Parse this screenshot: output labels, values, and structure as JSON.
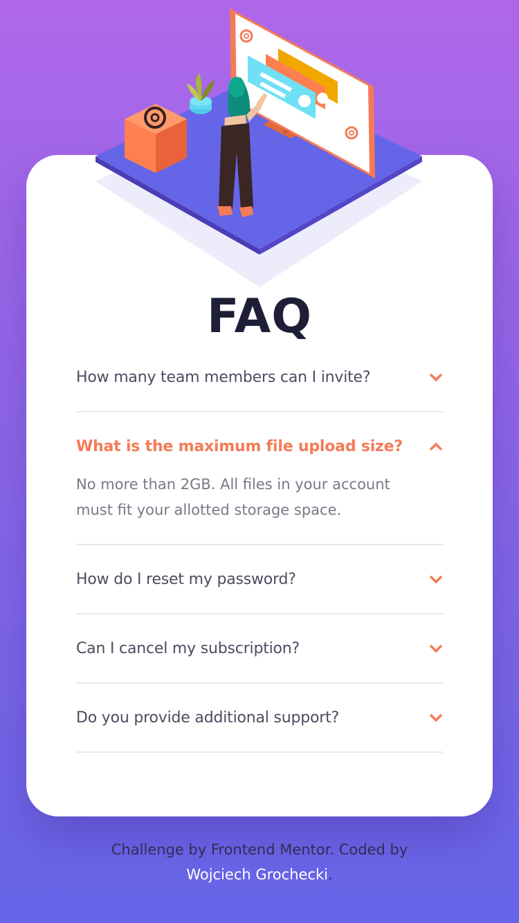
{
  "page": {
    "title": "FAQ"
  },
  "faq": {
    "items": [
      {
        "question": "How many team members can I invite?",
        "answer": "",
        "open": false
      },
      {
        "question": "What is the maximum file upload size?",
        "answer": "No more than 2GB. All files in your account must fit your allotted storage space.",
        "open": true
      },
      {
        "question": "How do I reset my password?",
        "answer": "",
        "open": false
      },
      {
        "question": "Can I cancel my subscription?",
        "answer": "",
        "open": false
      },
      {
        "question": "Do you provide additional support?",
        "answer": "",
        "open": false
      }
    ],
    "chevron_icon": "chevron-icon"
  },
  "footer": {
    "prefix": "Challenge by Frontend Mentor. Coded by",
    "author": "Wojciech Grochecki",
    "suffix": "."
  },
  "colors": {
    "bg_top": "#AF67E9",
    "bg_bottom": "#6565E7",
    "accent": "#F47B56",
    "title": "#1E1F36",
    "question": "#4B4C5F",
    "answer": "#787887",
    "divider": "#E8E8EA"
  }
}
